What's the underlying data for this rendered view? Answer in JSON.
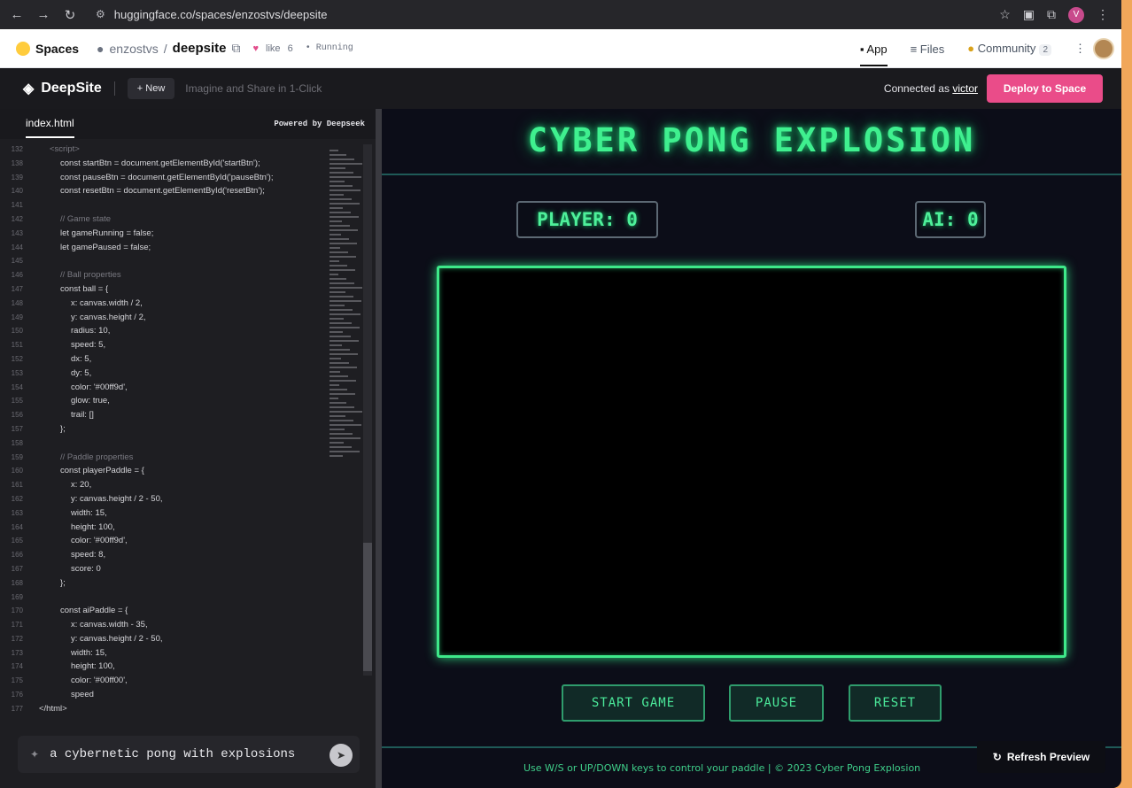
{
  "browser": {
    "url": "huggingface.co/spaces/enzostvs/deepsite",
    "icons": [
      "back-icon",
      "forward-icon",
      "reload-icon",
      "site-settings-icon",
      "star-icon",
      "extension-icon",
      "puzzle-icon",
      "menu-icon"
    ],
    "profile_initial": "V"
  },
  "hf": {
    "brand": "Spaces",
    "owner": "enzostvs",
    "repo": "deepsite",
    "like_label": "like",
    "like_count": "6",
    "status": "Running",
    "tabs": [
      {
        "label": "App",
        "active": true
      },
      {
        "label": "Files",
        "active": false
      },
      {
        "label": "Community",
        "active": false,
        "count": "2"
      }
    ],
    "more": "⋮"
  },
  "deepsite": {
    "name": "DeepSite",
    "new_label": "New",
    "tagline": "Imagine and Share in 1-Click",
    "connected_prefix": "Connected as",
    "user": "victor",
    "deploy_label": "Deploy to Space"
  },
  "editor": {
    "tab": "index.html",
    "powered": "Powered by  Deepseek",
    "lines": [
      {
        "n": "132",
        "t": "<script>",
        "i": 1,
        "dim": true
      },
      {
        "n": "138",
        "t": "const startBtn = document.getElementById('startBtn');",
        "i": 2
      },
      {
        "n": "139",
        "t": "const pauseBtn = document.getElementById('pauseBtn');",
        "i": 2
      },
      {
        "n": "140",
        "t": "const resetBtn = document.getElementById('resetBtn');",
        "i": 2
      },
      {
        "n": "141",
        "t": "",
        "i": 2
      },
      {
        "n": "142",
        "t": "// Game state",
        "i": 2,
        "dim": true
      },
      {
        "n": "143",
        "t": "let gameRunning = false;",
        "i": 2
      },
      {
        "n": "144",
        "t": "let gamePaused = false;",
        "i": 2
      },
      {
        "n": "145",
        "t": "",
        "i": 2
      },
      {
        "n": "146",
        "t": "// Ball properties",
        "i": 2,
        "dim": true
      },
      {
        "n": "147",
        "t": "const ball = {",
        "i": 2
      },
      {
        "n": "148",
        "t": "x: canvas.width / 2,",
        "i": 3
      },
      {
        "n": "149",
        "t": "y: canvas.height / 2,",
        "i": 3
      },
      {
        "n": "150",
        "t": "radius: 10,",
        "i": 3
      },
      {
        "n": "151",
        "t": "speed: 5,",
        "i": 3
      },
      {
        "n": "152",
        "t": "dx: 5,",
        "i": 3
      },
      {
        "n": "153",
        "t": "dy: 5,",
        "i": 3
      },
      {
        "n": "154",
        "t": "color: '#00ff9d',",
        "i": 3
      },
      {
        "n": "155",
        "t": "glow: true,",
        "i": 3
      },
      {
        "n": "156",
        "t": "trail: []",
        "i": 3
      },
      {
        "n": "157",
        "t": "};",
        "i": 2
      },
      {
        "n": "158",
        "t": "",
        "i": 2
      },
      {
        "n": "159",
        "t": "// Paddle properties",
        "i": 2,
        "dim": true
      },
      {
        "n": "160",
        "t": "const playerPaddle = {",
        "i": 2
      },
      {
        "n": "161",
        "t": "x: 20,",
        "i": 3
      },
      {
        "n": "162",
        "t": "y: canvas.height / 2 - 50,",
        "i": 3
      },
      {
        "n": "163",
        "t": "width: 15,",
        "i": 3
      },
      {
        "n": "164",
        "t": "height: 100,",
        "i": 3
      },
      {
        "n": "165",
        "t": "color: '#00ff9d',",
        "i": 3
      },
      {
        "n": "166",
        "t": "speed: 8,",
        "i": 3
      },
      {
        "n": "167",
        "t": "score: 0",
        "i": 3
      },
      {
        "n": "168",
        "t": "};",
        "i": 2
      },
      {
        "n": "169",
        "t": "",
        "i": 2
      },
      {
        "n": "170",
        "t": "const aiPaddle = {",
        "i": 2
      },
      {
        "n": "171",
        "t": "x: canvas.width - 35,",
        "i": 3
      },
      {
        "n": "172",
        "t": "y: canvas.height / 2 - 50,",
        "i": 3
      },
      {
        "n": "173",
        "t": "width: 15,",
        "i": 3
      },
      {
        "n": "174",
        "t": "height: 100,",
        "i": 3
      },
      {
        "n": "175",
        "t": "color: '#00ff00',",
        "i": 3
      },
      {
        "n": "176",
        "t": "speed",
        "i": 3
      },
      {
        "n": "177",
        "t": "</html>",
        "i": 0
      }
    ],
    "prompt": "a cybernetic pong with explosions"
  },
  "game": {
    "title": "CYBER PONG EXPLOSION",
    "player_score": "PLAYER: 0",
    "ai_score": "AI: 0",
    "buttons": {
      "start": "START GAME",
      "pause": "PAUSE",
      "reset": "RESET"
    },
    "footer": "Use W/S or UP/DOWN keys to control your paddle | © 2023 Cyber Pong Explosion",
    "refresh": "Refresh Preview",
    "accent": "#3ee889"
  }
}
